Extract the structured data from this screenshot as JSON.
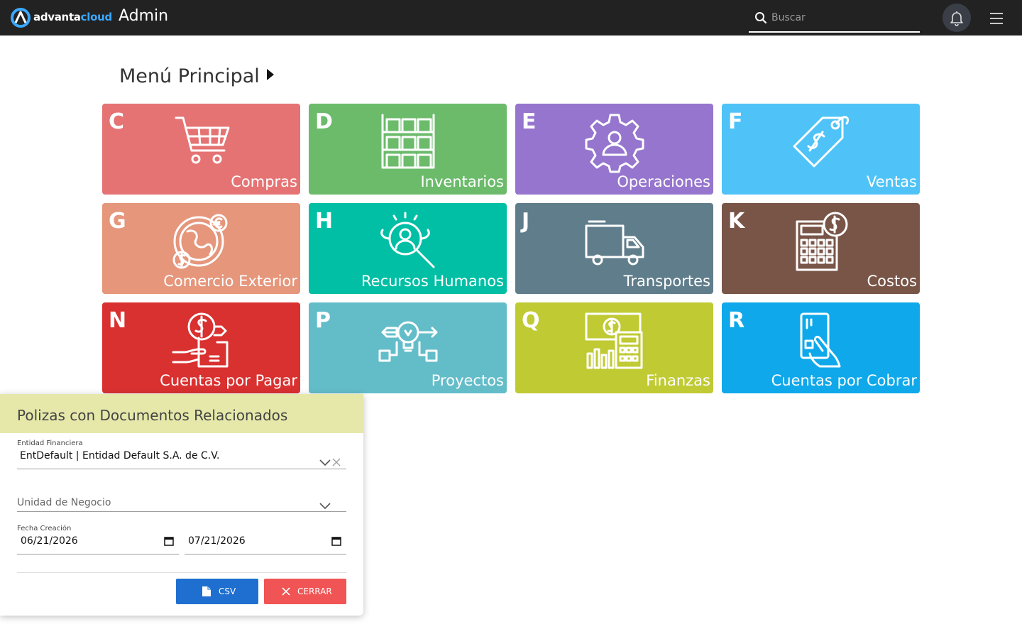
{
  "header": {
    "logo_part1": "advanta",
    "logo_part2": "cloud",
    "app_title": "Admin",
    "search_placeholder": "Buscar",
    "notification_icon": "bell-icon",
    "menu_icon": "hamburger-menu-icon"
  },
  "main": {
    "title": "Menú Principal",
    "tiles": [
      {
        "letter": "C",
        "label": "Compras",
        "color": "#e57373",
        "icon": "shopping-cart-icon"
      },
      {
        "letter": "D",
        "label": "Inventarios",
        "color": "#6bbb6b",
        "icon": "warehouse-boxes-icon"
      },
      {
        "letter": "E",
        "label": "Operaciones",
        "color": "#9575cd",
        "icon": "gear-user-icon"
      },
      {
        "letter": "F",
        "label": "Ventas",
        "color": "#4fc3f7",
        "icon": "price-tag-icon"
      },
      {
        "letter": "G",
        "label": "Comercio Exterior",
        "color": "#e5967b",
        "icon": "globe-currency-icon"
      },
      {
        "letter": "H",
        "label": "Recursos Humanos",
        "color": "#00bfa5",
        "icon": "user-search-icon"
      },
      {
        "letter": "J",
        "label": "Transportes",
        "color": "#607d8b",
        "icon": "truck-icon"
      },
      {
        "letter": "K",
        "label": "Costos",
        "color": "#795548",
        "icon": "calculator-dollar-icon"
      },
      {
        "letter": "N",
        "label": "Cuentas por Pagar",
        "color": "#d93030",
        "icon": "hand-coin-icon"
      },
      {
        "letter": "P",
        "label": "Proyectos",
        "color": "#63bdc9",
        "icon": "lightbulb-project-icon"
      },
      {
        "letter": "Q",
        "label": "Finanzas",
        "color": "#c0ca33",
        "icon": "finance-calculator-icon"
      },
      {
        "letter": "R",
        "label": "Cuentas por Cobrar",
        "color": "#0fa8ea",
        "icon": "hand-card-icon"
      }
    ]
  },
  "report_panel": {
    "title": "Polizas con Documentos Relacionados",
    "header_color": "#e6e8aa",
    "entidad": {
      "label": "Entidad Financiera",
      "value": "EntDefault | Entidad Default S.A. de C.V."
    },
    "unidad": {
      "placeholder": "Unidad de Negocio"
    },
    "fecha": {
      "label": "Fecha Creación",
      "from": "06/21/2026",
      "to": "07/21/2026"
    },
    "csv_button": {
      "label": "CSV",
      "color": "#1e6fcf"
    },
    "close_button": {
      "label": "CERRAR",
      "color": "#f05454"
    }
  }
}
